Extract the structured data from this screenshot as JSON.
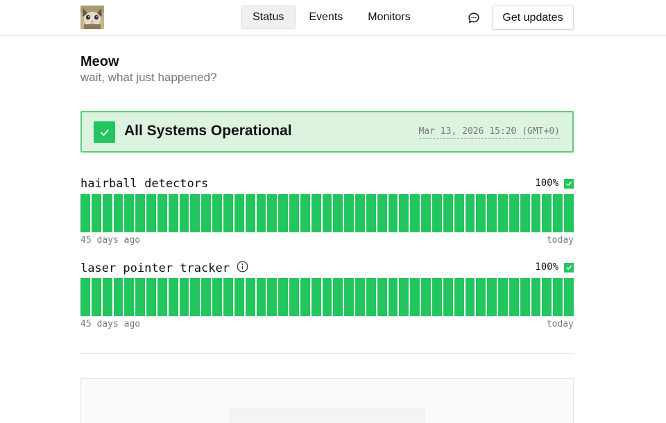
{
  "header": {
    "nav": [
      {
        "label": "Status",
        "active": true
      },
      {
        "label": "Events",
        "active": false
      },
      {
        "label": "Monitors",
        "active": false
      }
    ],
    "chat_icon": "chat-bubble-icon",
    "updates_label": "Get updates"
  },
  "page": {
    "title": "Meow",
    "subtitle": "wait, what just happened?"
  },
  "status": {
    "title": "All Systems Operational",
    "timestamp": "Mar 13, 2026 15:20 (GMT+0)",
    "icon": "check-icon",
    "color": "#22c55e"
  },
  "monitors": [
    {
      "name": "hairball detectors",
      "uptime": "100%",
      "has_info": false,
      "range_start": "45 days ago",
      "range_end": "today",
      "days": [
        "up",
        "up",
        "up",
        "up",
        "up",
        "up",
        "up",
        "up",
        "up",
        "up",
        "up",
        "up",
        "up",
        "up",
        "up",
        "up",
        "up",
        "up",
        "up",
        "up",
        "up",
        "up",
        "up",
        "up",
        "up",
        "up",
        "up",
        "up",
        "up",
        "up",
        "up",
        "up",
        "up",
        "up",
        "up",
        "up",
        "up",
        "up",
        "up",
        "up",
        "up",
        "up",
        "up",
        "up",
        "up"
      ]
    },
    {
      "name": "laser pointer tracker",
      "uptime": "100%",
      "has_info": true,
      "range_start": "45 days ago",
      "range_end": "today",
      "days": [
        "up",
        "up",
        "up",
        "up",
        "up",
        "up",
        "up",
        "up",
        "up",
        "up",
        "up",
        "up",
        "up",
        "up",
        "up",
        "up",
        "up",
        "up",
        "up",
        "up",
        "up",
        "up",
        "up",
        "up",
        "up",
        "up",
        "up",
        "up",
        "up",
        "up",
        "up",
        "up",
        "up",
        "up",
        "up",
        "up",
        "up",
        "up",
        "up",
        "up",
        "up",
        "up",
        "up",
        "up",
        "up"
      ]
    }
  ]
}
